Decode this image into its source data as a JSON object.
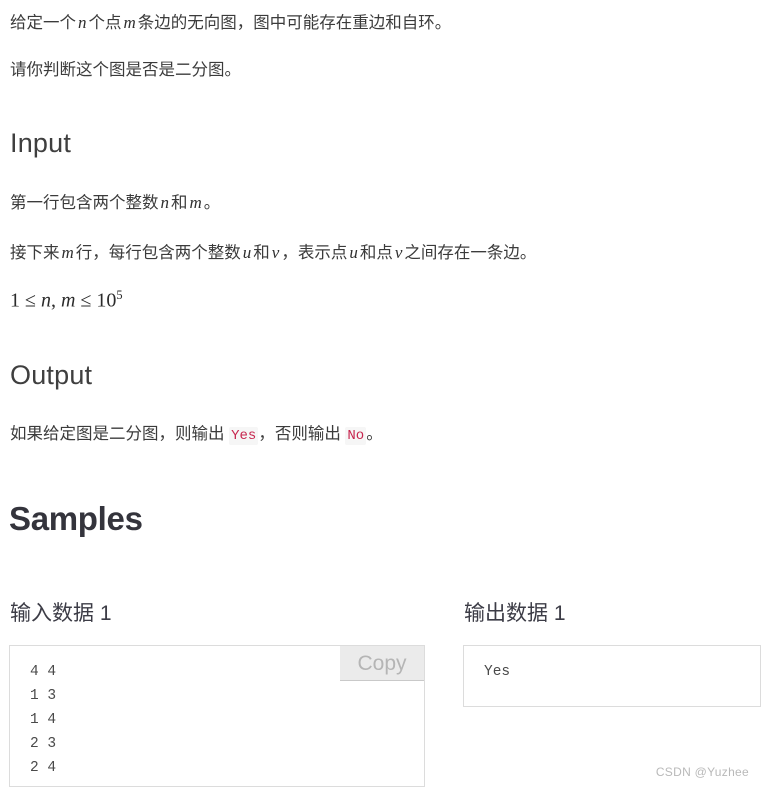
{
  "problem": {
    "statement_line1": {
      "seg1": "给定一个",
      "var_n": "n",
      "seg2": "个点",
      "var_m": "m",
      "seg3": "条边的无向图，图中可能存在重边和自环。"
    },
    "statement_line2": "请你判断这个图是否是二分图。"
  },
  "input_section": {
    "heading": "Input",
    "line1": {
      "seg1": "第一行包含两个整数",
      "var_n": "n",
      "seg2": "和",
      "var_m": "m",
      "seg3": "。"
    },
    "line2": {
      "seg1": "接下来",
      "var_m": "m",
      "seg2": "行，每行包含两个整数",
      "var_u": "u",
      "seg3": "和",
      "var_v": "v",
      "seg4": "，表示点",
      "var_u2": "u",
      "seg5": "和点",
      "var_v2": "v",
      "seg6": "之间存在一条边。"
    },
    "constraint": {
      "one": "1",
      "le1": "≤",
      "var_n": "n",
      "comma": ",",
      "var_m": "m",
      "le2": "≤",
      "base": "10",
      "exponent": "5"
    }
  },
  "output_section": {
    "heading": "Output",
    "line1_seg1": "如果给定图是二分图，则输出",
    "code_yes": "Yes",
    "line1_seg2": "，否则输出",
    "code_no": "No",
    "line1_seg3": "。"
  },
  "samples_section": {
    "heading": "Samples",
    "input_label": "输入数据 1",
    "output_label": "输出数据 1",
    "input_code": "4 4\n1 3\n1 4\n2 3\n2 4",
    "output_code": "Yes",
    "copy_label": "Copy"
  },
  "watermark": "CSDN @Yuzhee",
  "colors": {
    "inline_code_text": "#c7254e",
    "inline_code_bg": "#f6f6f6",
    "body_text": "#3b3b3b",
    "border": "#dcdcdc",
    "copy_bg": "#ebebeb",
    "copy_text": "#b5b5b5",
    "watermark": "#b9b9b9"
  }
}
